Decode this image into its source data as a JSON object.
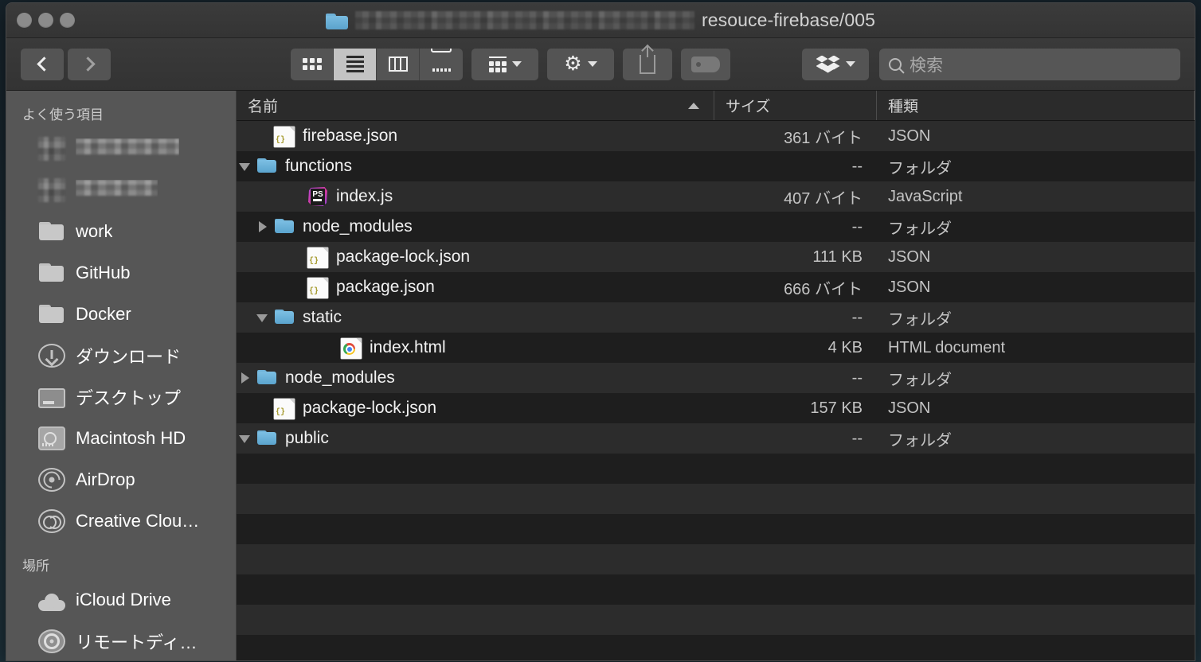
{
  "window": {
    "title_redacted_prefix": true,
    "title": "resouce-firebase/005",
    "traffic_lights": [
      "close",
      "minimize",
      "zoom"
    ]
  },
  "toolbar": {
    "back_label": "戻る",
    "forward_label": "進む",
    "view_buttons": [
      {
        "name": "icon-view",
        "icon": "grid-icon",
        "active": false
      },
      {
        "name": "list-view",
        "icon": "list-icon",
        "active": true
      },
      {
        "name": "column-view",
        "icon": "columns-icon",
        "active": false
      },
      {
        "name": "gallery-view",
        "icon": "gallery-icon",
        "active": false
      }
    ],
    "arrange_label": "グループ分け",
    "action_label": "操作",
    "share_label": "共有",
    "tags_label": "タグ",
    "dropbox_label": "Dropbox"
  },
  "search": {
    "placeholder": "検索",
    "value": ""
  },
  "sidebar": {
    "sections": [
      {
        "header": "よく使う項目",
        "items": [
          {
            "label": "",
            "icon": "redacted-icon",
            "redacted": true,
            "redact_width": "w1"
          },
          {
            "label": "",
            "icon": "redacted-icon",
            "redacted": true,
            "redact_width": "w2"
          },
          {
            "label": "work",
            "icon": "folder-icon"
          },
          {
            "label": "GitHub",
            "icon": "folder-icon"
          },
          {
            "label": "Docker",
            "icon": "folder-icon"
          },
          {
            "label": "ダウンロード",
            "icon": "downloads-icon"
          },
          {
            "label": "デスクトップ",
            "icon": "desktop-icon"
          },
          {
            "label": "Macintosh HD",
            "icon": "harddisk-icon"
          },
          {
            "label": "AirDrop",
            "icon": "airdrop-icon"
          },
          {
            "label": "Creative Clou…",
            "icon": "creative-cloud-icon"
          }
        ]
      },
      {
        "header": "場所",
        "items": [
          {
            "label": "iCloud Drive",
            "icon": "cloud-icon"
          },
          {
            "label": "リモートディ…",
            "icon": "disc-icon"
          }
        ]
      }
    ]
  },
  "filelist": {
    "columns": [
      {
        "key": "name",
        "label": "名前",
        "sorted": true,
        "sort_direction": "ascending"
      },
      {
        "key": "size",
        "label": "サイズ",
        "sorted": false
      },
      {
        "key": "kind",
        "label": "種類",
        "sorted": false
      }
    ],
    "rows": [
      {
        "name": "firebase.json",
        "size": "361 バイト",
        "kind": "JSON",
        "icon": "json-file-icon",
        "indent": 1,
        "disclosure": "none"
      },
      {
        "name": "functions",
        "size": "--",
        "kind": "フォルダ",
        "icon": "folder-icon",
        "indent": 0,
        "disclosure": "open"
      },
      {
        "name": "index.js",
        "size": "407 バイト",
        "kind": "JavaScript",
        "icon": "phpstorm-file-icon",
        "indent": 2,
        "disclosure": "none"
      },
      {
        "name": "node_modules",
        "size": "--",
        "kind": "フォルダ",
        "icon": "folder-icon",
        "indent": 1,
        "disclosure": "closed"
      },
      {
        "name": "package-lock.json",
        "size": "111 KB",
        "kind": "JSON",
        "icon": "json-file-icon",
        "indent": 2,
        "disclosure": "none"
      },
      {
        "name": "package.json",
        "size": "666 バイト",
        "kind": "JSON",
        "icon": "json-file-icon",
        "indent": 2,
        "disclosure": "none"
      },
      {
        "name": "static",
        "size": "--",
        "kind": "フォルダ",
        "icon": "folder-icon",
        "indent": 1,
        "disclosure": "open"
      },
      {
        "name": "index.html",
        "size": "4 KB",
        "kind": "HTML document",
        "icon": "chrome-file-icon",
        "indent": 3,
        "disclosure": "none"
      },
      {
        "name": "node_modules",
        "size": "--",
        "kind": "フォルダ",
        "icon": "folder-icon",
        "indent": 0,
        "disclosure": "closed"
      },
      {
        "name": "package-lock.json",
        "size": "157 KB",
        "kind": "JSON",
        "icon": "json-file-icon",
        "indent": 1,
        "disclosure": "none"
      },
      {
        "name": "public",
        "size": "--",
        "kind": "フォルダ",
        "icon": "folder-icon",
        "indent": 0,
        "disclosure": "open"
      }
    ],
    "empty_row_count": 7
  },
  "colors": {
    "window_chrome": "#383838",
    "sidebar_bg": "#565656",
    "list_bg": "#1e1e1e",
    "list_stripe": "#2c2c2c",
    "folder_blue": "#6fb2d8",
    "text_primary": "#f2f2f2",
    "text_secondary": "#c4c4c4"
  }
}
